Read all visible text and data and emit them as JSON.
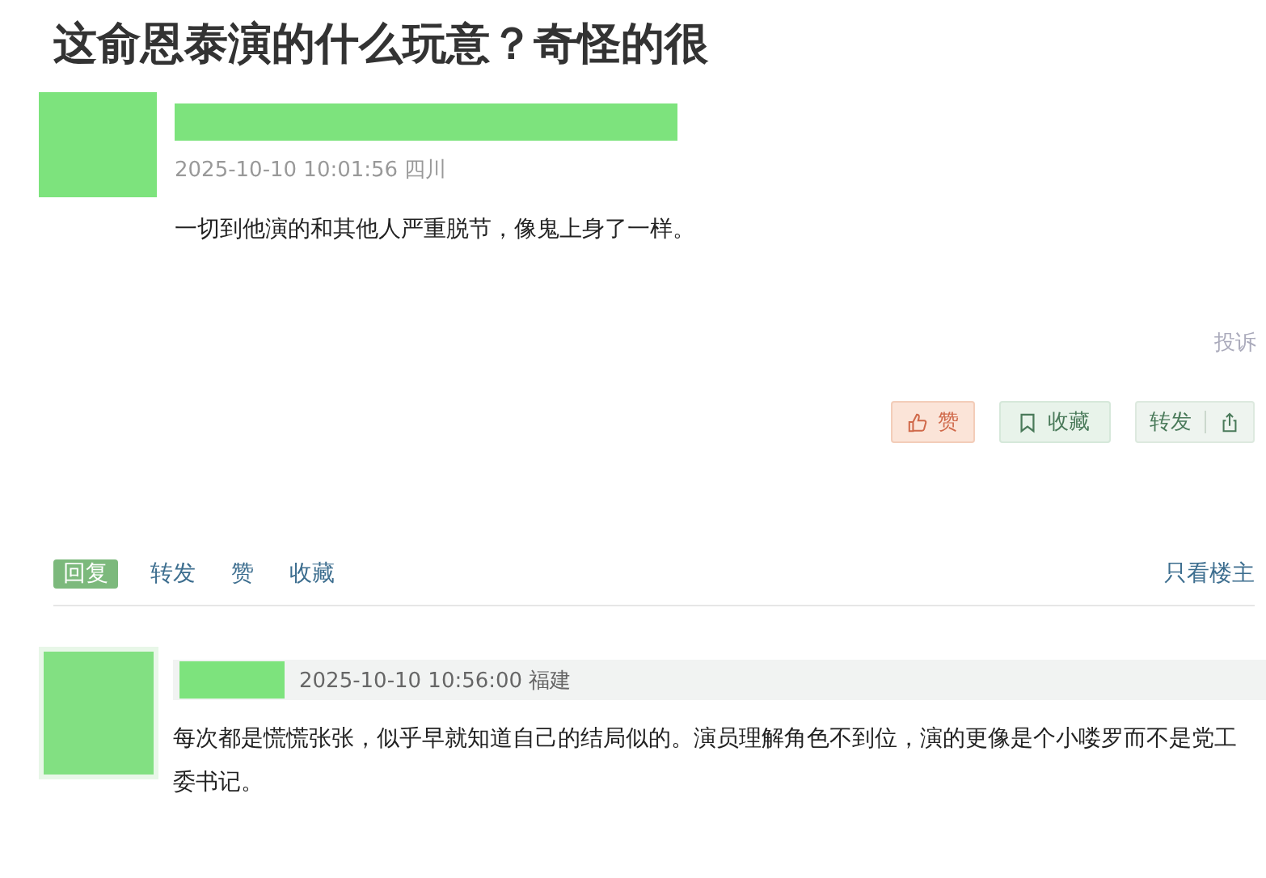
{
  "title": "这俞恩泰演的什么玩意？奇怪的很",
  "post": {
    "meta": "2025-10-10 10:01:56 四川",
    "content": "一切到他演的和其他人严重脱节，像鬼上身了一样。",
    "report": "投诉"
  },
  "actions": [
    {
      "kind": "like",
      "label": "赞"
    },
    {
      "kind": "collect",
      "label": "收藏"
    },
    {
      "kind": "share",
      "label": "转发"
    }
  ],
  "tabs": [
    {
      "label": "回复",
      "selected": true
    },
    {
      "label": "转发",
      "selected": false
    },
    {
      "label": "赞",
      "selected": false
    },
    {
      "label": "收藏",
      "selected": false
    }
  ],
  "filter": "只看楼主",
  "replies": [
    {
      "meta": "2025-10-10 10:56:00 福建",
      "content": "每次都是慌慌张张，似乎早就知道自己的结局似的。演员理解角色不到位，演的更像是个小喽罗而不是党工委书记。"
    }
  ]
}
